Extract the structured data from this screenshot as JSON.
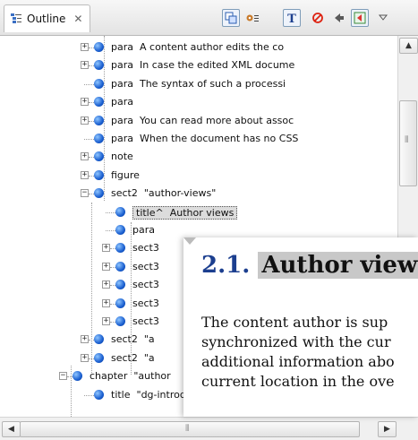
{
  "view": {
    "tab_title": "Outline",
    "close_glyph": "✕"
  },
  "toolbar": [
    {
      "name": "toolbar-link-editor-icon"
    },
    {
      "name": "toolbar-settings-icon"
    },
    {
      "name": "toolbar-show-text-icon"
    },
    {
      "name": "toolbar-stop-icon"
    },
    {
      "name": "toolbar-back-icon"
    },
    {
      "name": "toolbar-sync-icon"
    },
    {
      "name": "toolbar-menu-icon"
    }
  ],
  "tree": [
    {
      "exp": "+",
      "tag": "para",
      "text": "A content author edits the co"
    },
    {
      "exp": "+",
      "tag": "para",
      "text": "In case the edited XML docume"
    },
    {
      "exp": "",
      "tag": "para",
      "text": "The syntax of such a processi"
    },
    {
      "exp": "+",
      "tag": "para",
      "text": ""
    },
    {
      "exp": "+",
      "tag": "para",
      "text": "You can read more about assoc"
    },
    {
      "exp": "",
      "tag": "para",
      "text": "When the document has no CSS"
    },
    {
      "exp": "+",
      "tag": "note",
      "text": ""
    },
    {
      "exp": "+",
      "tag": "figure",
      "text": ""
    },
    {
      "exp": "−",
      "tag": "sect2",
      "text": "\"author-views\""
    },
    {
      "exp": "",
      "tag": "title^",
      "text": "Author views",
      "selected": true
    },
    {
      "exp": "",
      "tag": "para",
      "text": ""
    },
    {
      "exp": "+",
      "tag": "sect3",
      "text": ""
    },
    {
      "exp": "+",
      "tag": "sect3",
      "text": ""
    },
    {
      "exp": "+",
      "tag": "sect3",
      "text": ""
    },
    {
      "exp": "+",
      "tag": "sect3",
      "text": ""
    },
    {
      "exp": "+",
      "tag": "sect3",
      "text": ""
    },
    {
      "exp": "+",
      "tag": "sect2",
      "text": "\"a"
    },
    {
      "exp": "+",
      "tag": "sect2",
      "text": "\"a"
    },
    {
      "exp": "−",
      "tag": "chapter",
      "text": "\"author"
    },
    {
      "exp": "",
      "tag": "title",
      "text": "\"dg-introduction\" oXygen XML Editor Developer"
    }
  ],
  "popup": {
    "number": "2.1.",
    "heading": "Author view",
    "lines": [
      "The content author is sup",
      "synchronized with the cur",
      "additional information abo",
      "current location in the ove"
    ]
  },
  "scrollbars": {
    "up": "▲",
    "down": "▼",
    "left": "◀",
    "right": "▶",
    "grip": "⦀"
  }
}
